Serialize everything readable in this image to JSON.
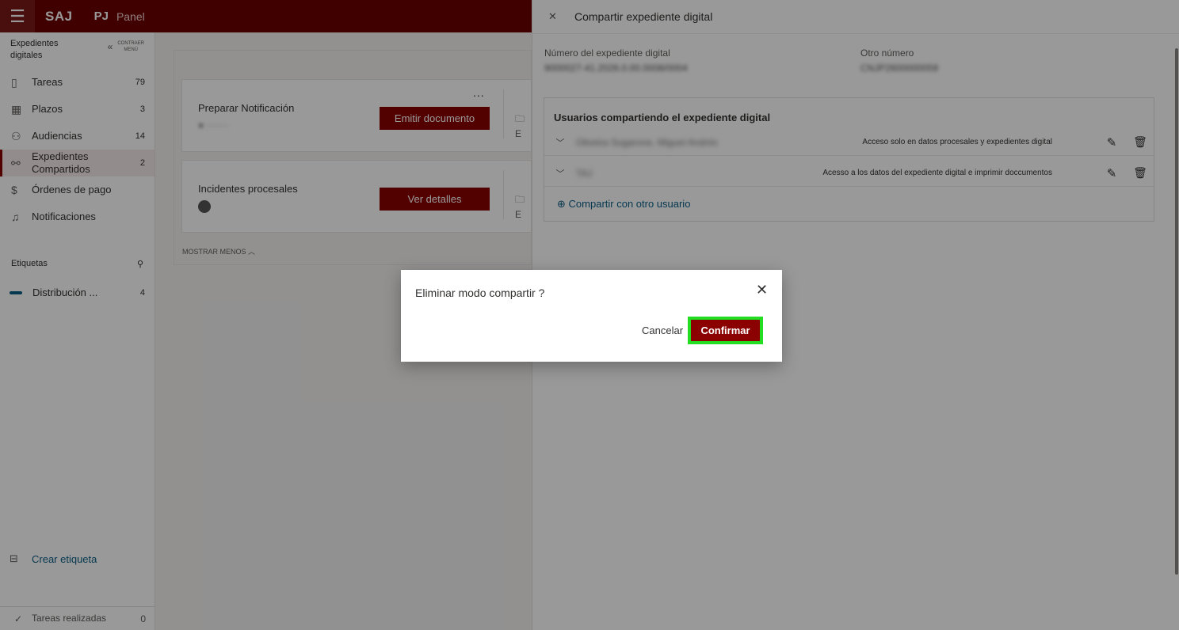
{
  "topbar": {
    "brand": "SAJ",
    "brand2": "PJ",
    "panel": "Panel"
  },
  "sidebar": {
    "title": "Expedientes digitales",
    "collapse_line1": "CONTRAER",
    "collapse_line2": "MENÚ",
    "items": [
      {
        "label": "Tareas",
        "count": "79",
        "icon": "clipboard-icon"
      },
      {
        "label": "Plazos",
        "count": "3",
        "icon": "calendar-icon"
      },
      {
        "label": "Audiencias",
        "count": "14",
        "icon": "people-icon"
      },
      {
        "label": "Expedientes Compartidos",
        "count": "2",
        "icon": "shared-users-icon"
      },
      {
        "label": "Órdenes de pago",
        "count": "",
        "icon": "dollar-icon"
      },
      {
        "label": "Notificaciones",
        "count": "",
        "icon": "bell-icon"
      }
    ],
    "tags_header": "Etiquetas",
    "tags": [
      {
        "label": "Distribución ...",
        "count": "4",
        "color": "#0b5f86"
      }
    ],
    "create_tag": "Crear etiqueta",
    "done": {
      "label": "Tareas realizadas",
      "count": "0"
    }
  },
  "main": {
    "cards": [
      {
        "title": "Preparar Notificación",
        "button": "Emitir documento",
        "folder": "E"
      },
      {
        "title": "Incidentes procesales",
        "button": "Ver detalles",
        "folder": "E"
      }
    ],
    "more_dots": "...",
    "show_less": "MOSTRAR MENOS"
  },
  "panel": {
    "title": "Compartir expediente digital",
    "field1_label": "Número del expediente digital",
    "field1_value": "9000027-41.2026.0.00.0008/0004",
    "field2_label": "Otro número",
    "field2_value": "CNJP2600000059",
    "users_header": "Usuarios compartiendo el expediente digital",
    "users": [
      {
        "name": "Oliveira Sugarone, Miguel Andrés",
        "access": "Acceso solo en datos procesales y expedientes digital"
      },
      {
        "name": "TAJ",
        "access": "Acesso a los datos del expediente digital e imprimir doccumentos"
      }
    ],
    "share_link": "Compartir con otro usuario"
  },
  "dialog": {
    "title": "Eliminar modo compartir ?",
    "cancel": "Cancelar",
    "confirm": "Confirmar"
  },
  "colors": {
    "brand": "#8b0000",
    "topbar": "#6b0000",
    "link": "#0b5f86",
    "highlight": "#22dd22"
  }
}
